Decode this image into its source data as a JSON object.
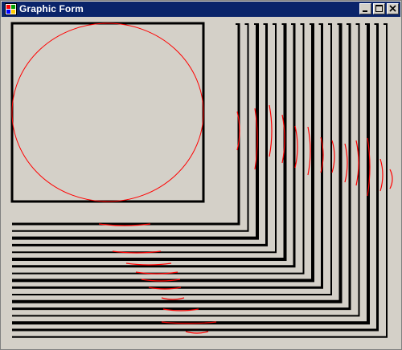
{
  "window": {
    "title": "Graphic Form",
    "title_bar_color": "#0a246a",
    "title_text_color": "#ffffff",
    "background_color": "#d4d0c8"
  },
  "title_buttons": [
    {
      "name": "minimize-button",
      "icon": "minimize-icon"
    },
    {
      "name": "maximize-button",
      "icon": "maximize-icon"
    },
    {
      "name": "close-button",
      "icon": "close-icon"
    }
  ],
  "drawing": {
    "square_color": "#000000",
    "circle_color": "#ff0000",
    "line_color": "#000000",
    "arc_color": "#ff0000"
  }
}
